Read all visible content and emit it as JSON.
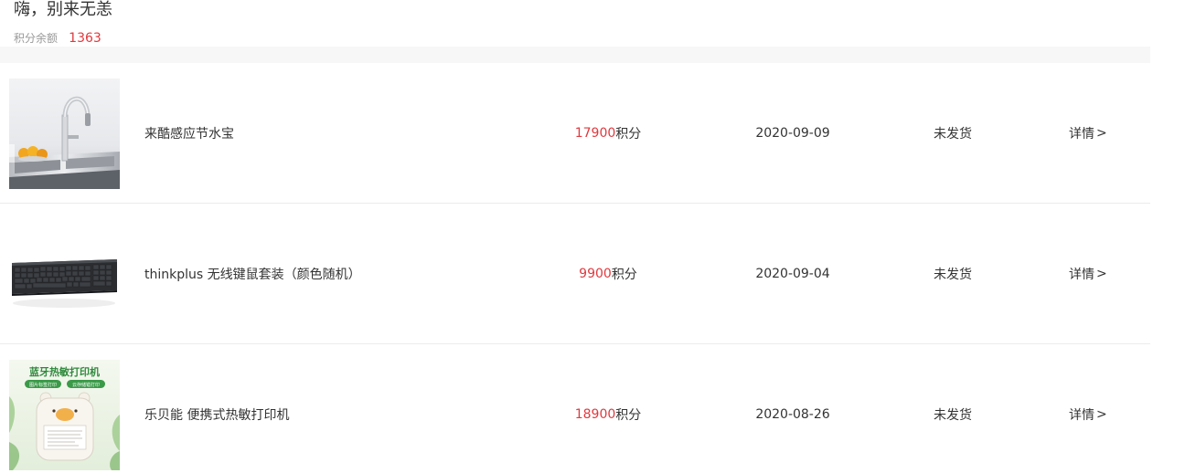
{
  "header": {
    "greeting": "嗨，别来无恙",
    "points_label": "积分余额",
    "points_value": "1363"
  },
  "orders": [
    {
      "name": "来酷感应节水宝",
      "points": "17900",
      "points_unit": "积分",
      "date": "2020-09-09",
      "status": "未发货",
      "detail_label": "详情",
      "detail_arrow": ">"
    },
    {
      "name": "thinkplus 无线键鼠套装（颜色随机）",
      "points": "9900",
      "points_unit": "积分",
      "date": "2020-09-04",
      "status": "未发货",
      "detail_label": "详情",
      "detail_arrow": ">"
    },
    {
      "name": "乐贝能 便携式热敏打印机",
      "points": "18900",
      "points_unit": "积分",
      "date": "2020-08-26",
      "status": "未发货",
      "detail_label": "详情",
      "detail_arrow": ">",
      "image_text": {
        "title": "蓝牙热敏打印机",
        "tag_left": "图片标签打印",
        "tag_right": "云存储错打印"
      }
    }
  ],
  "colors": {
    "accent_red": "#e0393e",
    "muted_text": "#999999",
    "body_text": "#333333",
    "divider": "#ececec"
  },
  "icons": [
    "faucet-image",
    "keyboard-image",
    "printer-image"
  ]
}
